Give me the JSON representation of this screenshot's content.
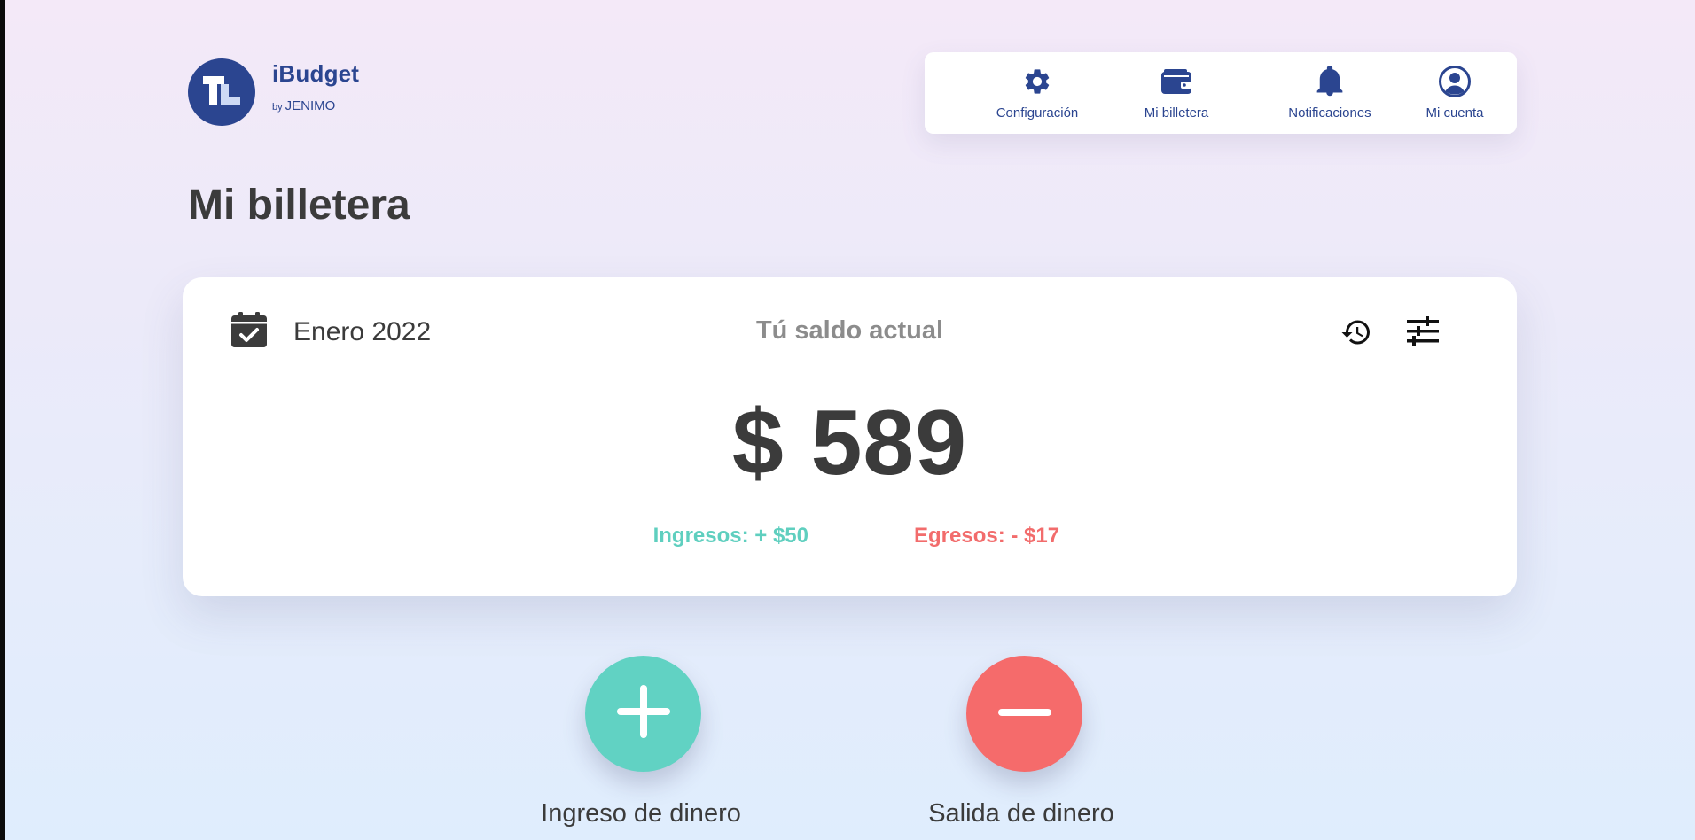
{
  "brand": {
    "name": "iBudget",
    "by": "by",
    "maker": "JENIMO",
    "color": "#2b4590"
  },
  "nav": {
    "items": [
      {
        "label": "Configuración",
        "icon": "gear-icon"
      },
      {
        "label": "Mi billetera",
        "icon": "wallet-icon"
      },
      {
        "label": "Notificaciones",
        "icon": "bell-icon"
      },
      {
        "label": "Mi cuenta",
        "icon": "account-icon"
      }
    ]
  },
  "page": {
    "title": "Mi billetera"
  },
  "wallet": {
    "period": "Enero 2022",
    "caption": "Tú saldo actual",
    "balance": "$ 589",
    "income": "Ingresos: + $50",
    "expense": "Egresos: - $17",
    "tools": [
      "history-icon",
      "filter-sliders-icon"
    ],
    "colors": {
      "income": "#5fcfbf",
      "expense": "#f26c6c"
    }
  },
  "actions": {
    "add_label": "Ingreso de dinero",
    "remove_label": "Salida de dinero",
    "add_color": "#61d2c3",
    "remove_color": "#f56b6b"
  }
}
